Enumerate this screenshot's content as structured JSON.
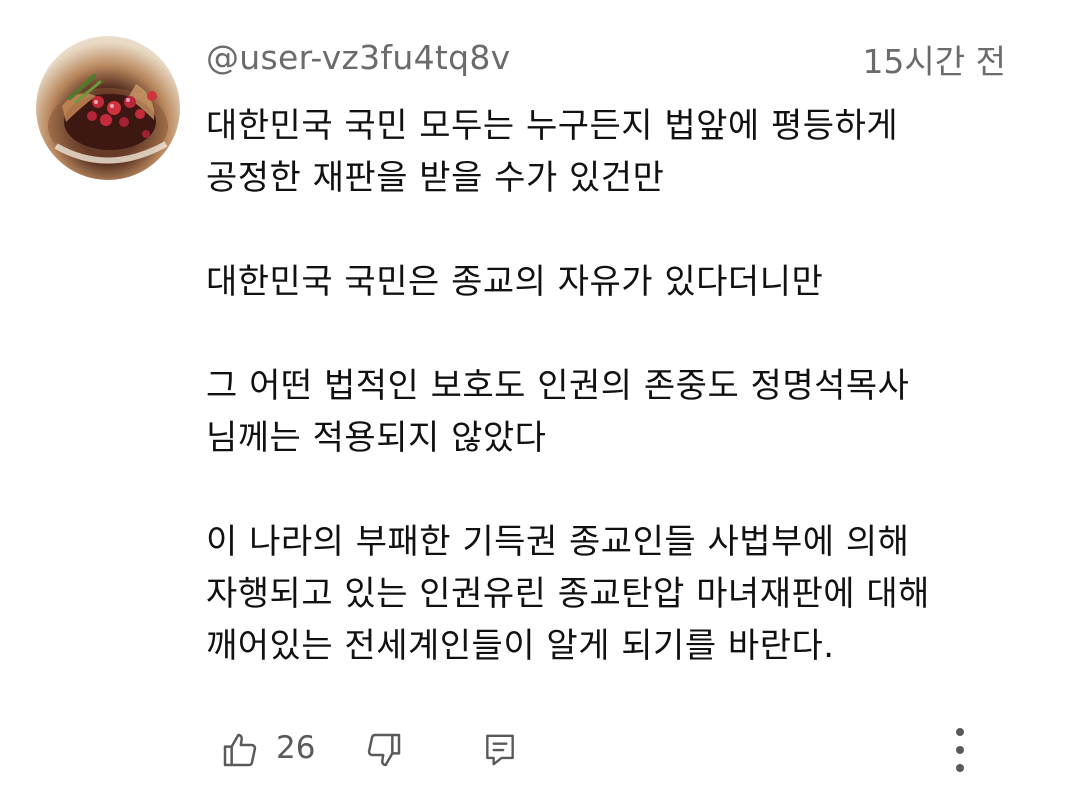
{
  "comment": {
    "author": "@user-vz3fu4tq8v",
    "time": "15시간 전",
    "paragraphs": [
      [
        "대한민국 국민 모두는 누구든지 법앞에 평등하게",
        "공정한 재판을 받을 수가 있건만"
      ],
      [
        "대한민국 국민은 종교의  자유가 있다더니만"
      ],
      [
        "그 어떤 법적인 보호도 인권의 존중도 정명석목사",
        "님께는 적용되지 않았다"
      ],
      [
        "이 나라의 부패한 기득권 종교인들 사법부에 의해",
        "자행되고 있는 인권유린 종교탄압 마녀재판에 대해",
        "깨어있는 전세계인들이 알게 되기를 바란다."
      ]
    ],
    "like_count": "26"
  },
  "icons": {
    "like": "thumbs-up-icon",
    "dislike": "thumbs-down-icon",
    "reply": "comment-icon",
    "more": "more-vertical-icon"
  },
  "colors": {
    "meta_text": "#6b6b6b",
    "body_text": "#111111",
    "icon": "#5a5a5a"
  }
}
